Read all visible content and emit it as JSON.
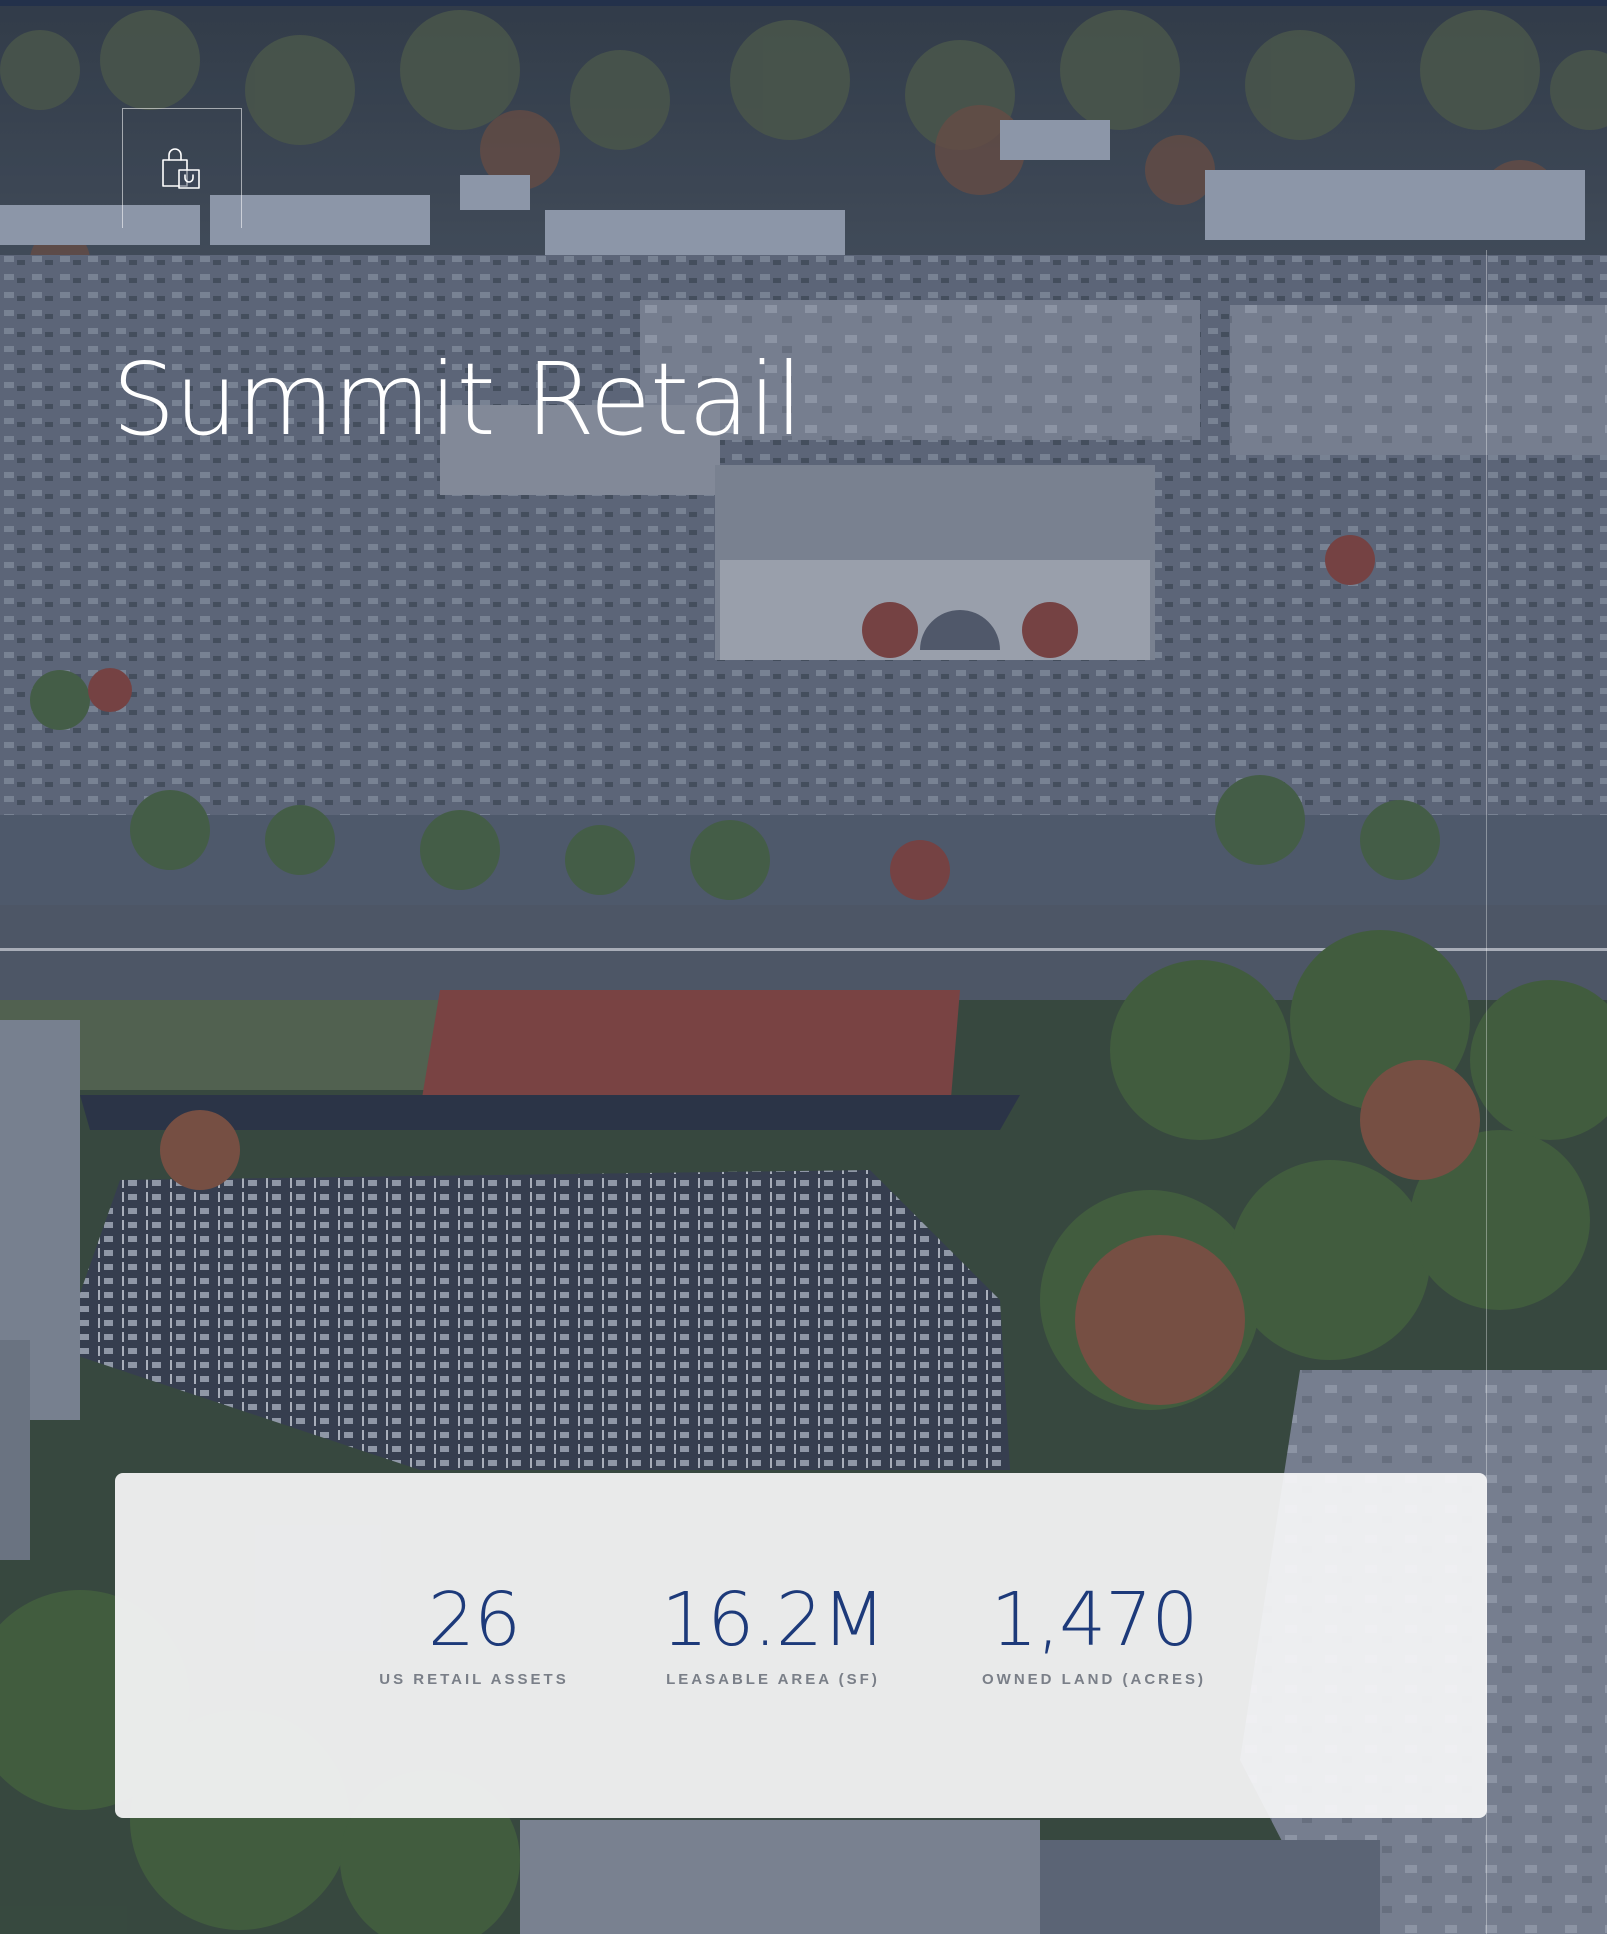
{
  "hero": {
    "title": "Summit Retail",
    "icon": "shopping-bags-icon"
  },
  "stats": [
    {
      "value": "26",
      "label": "US RETAIL ASSETS"
    },
    {
      "value": "16.2M",
      "label": "LEASABLE AREA (SF)"
    },
    {
      "value": "1,470",
      "label": "OWNED LAND (ACRES)"
    }
  ],
  "colors": {
    "accent": "#1d3a7a",
    "label": "#7a7f88",
    "card": "#f6f6f8"
  }
}
